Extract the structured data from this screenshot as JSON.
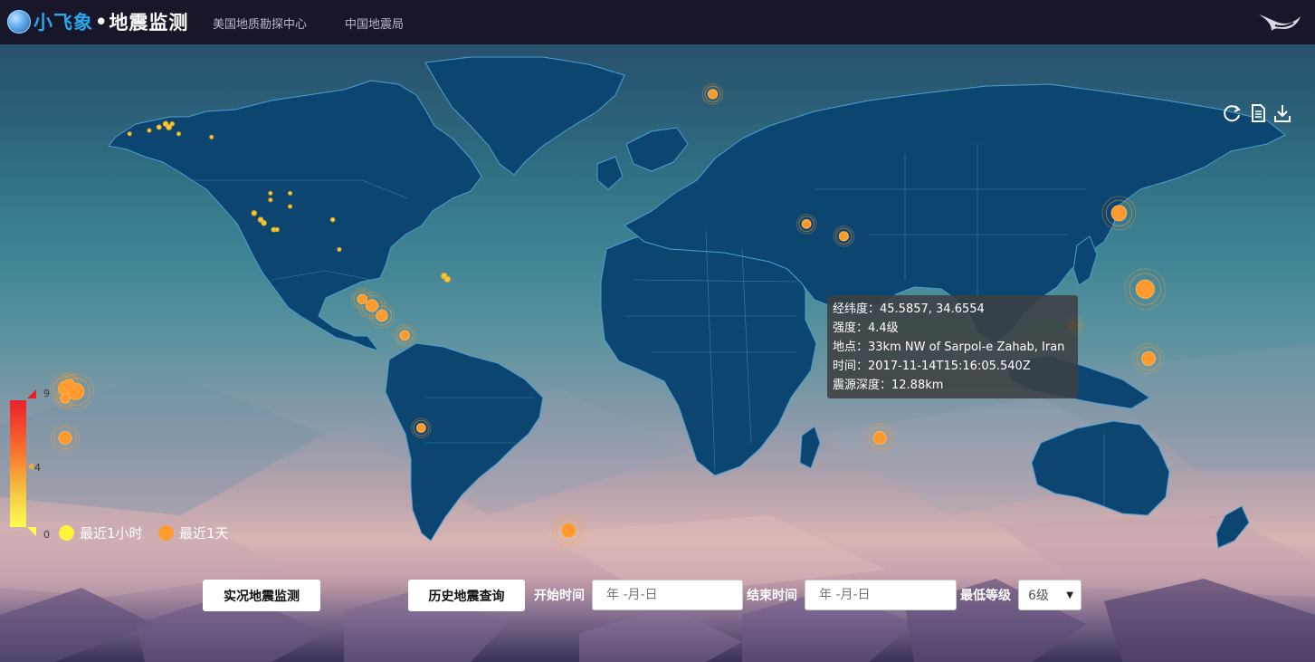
{
  "header": {
    "brand_primary": "小飞象",
    "brand_separator": "•",
    "brand_secondary": "地震监测",
    "nav": [
      "美国地质勘探中心",
      "中国地震局"
    ]
  },
  "toolbar": {
    "icons": [
      "refresh-icon",
      "document-icon",
      "download-icon"
    ]
  },
  "tooltip": {
    "coords": "经纬度：45.5857, 34.6554",
    "magnitude": "强度：4.4级",
    "place": "地点：33km NW of Sarpol-e Zahab, Iran",
    "time": "时间：2017-11-14T15:16:05.540Z",
    "depth": "震源深度：12.88km"
  },
  "legend": {
    "max": "9",
    "mid": "4",
    "min": "0",
    "last_hour": "最近1小时",
    "last_day": "最近1天",
    "colors": {
      "hour": "#fff23c",
      "day": "#ff9b2e",
      "high": "#e8202a",
      "low": "#fffb4e"
    }
  },
  "controls": {
    "live_button": "实况地震监测",
    "history_button": "历史地震查询",
    "start_label": "开始时间",
    "end_label": "结束时间",
    "date_placeholder": "年 -月-日",
    "level_label": "最低等级",
    "level_value": "6级"
  },
  "map": {
    "land_color": "#0c4670",
    "quakes": [
      {
        "lon": -161,
        "lat": 62,
        "mag": 2.0,
        "period": "hour"
      },
      {
        "lon": -155,
        "lat": 63,
        "mag": 2.0,
        "period": "hour"
      },
      {
        "lon": -152,
        "lat": 64,
        "mag": 2.4,
        "period": "hour"
      },
      {
        "lon": -150,
        "lat": 65,
        "mag": 2.6,
        "period": "hour"
      },
      {
        "lon": -149,
        "lat": 64,
        "mag": 2.8,
        "period": "hour"
      },
      {
        "lon": -148,
        "lat": 65,
        "mag": 2.2,
        "period": "hour"
      },
      {
        "lon": -146,
        "lat": 62,
        "mag": 2.0,
        "period": "hour"
      },
      {
        "lon": -136,
        "lat": 61,
        "mag": 2.0,
        "period": "hour"
      },
      {
        "lon": -118,
        "lat": 44,
        "mag": 2.0,
        "period": "hour"
      },
      {
        "lon": -118,
        "lat": 42,
        "mag": 2.0,
        "period": "hour"
      },
      {
        "lon": -112,
        "lat": 44,
        "mag": 2.0,
        "period": "hour"
      },
      {
        "lon": -112,
        "lat": 40,
        "mag": 2.0,
        "period": "hour"
      },
      {
        "lon": -123,
        "lat": 38,
        "mag": 2.6,
        "period": "hour"
      },
      {
        "lon": -121,
        "lat": 36,
        "mag": 2.6,
        "period": "hour"
      },
      {
        "lon": -120,
        "lat": 35,
        "mag": 2.6,
        "period": "hour"
      },
      {
        "lon": -117,
        "lat": 33,
        "mag": 2.4,
        "period": "hour"
      },
      {
        "lon": -116,
        "lat": 33,
        "mag": 2.2,
        "period": "hour"
      },
      {
        "lon": -99,
        "lat": 36,
        "mag": 2.2,
        "period": "hour"
      },
      {
        "lon": -97,
        "lat": 27,
        "mag": 2.0,
        "period": "hour"
      },
      {
        "lon": -65,
        "lat": 19,
        "mag": 3.0,
        "period": "hour"
      },
      {
        "lon": -64,
        "lat": 18,
        "mag": 3.0,
        "period": "hour"
      },
      {
        "lon": 17,
        "lat": 74,
        "mag": 4.5,
        "period": "day"
      },
      {
        "lon": 45.6,
        "lat": 34.7,
        "mag": 4.4,
        "period": "day"
      },
      {
        "lon": 57,
        "lat": 31,
        "mag": 4.5,
        "period": "day"
      },
      {
        "lon": -90,
        "lat": 12,
        "mag": 4.6,
        "period": "day"
      },
      {
        "lon": -87,
        "lat": 10,
        "mag": 5.2,
        "period": "day"
      },
      {
        "lon": -84,
        "lat": 7,
        "mag": 5.0,
        "period": "day"
      },
      {
        "lon": -77,
        "lat": 1,
        "mag": 4.6,
        "period": "day"
      },
      {
        "lon": -72,
        "lat": -27,
        "mag": 4.4,
        "period": "day"
      },
      {
        "lon": 141,
        "lat": 38,
        "mag": 6.0,
        "period": "day"
      },
      {
        "lon": 149,
        "lat": 15,
        "mag": 6.8,
        "period": "day"
      },
      {
        "lon": 150,
        "lat": -6,
        "mag": 5.6,
        "period": "day"
      },
      {
        "lon": 127,
        "lat": 4,
        "mag": 4.4,
        "period": "day"
      },
      {
        "lon": 68,
        "lat": -30,
        "mag": 5.4,
        "period": "day"
      },
      {
        "lon": -27,
        "lat": -58,
        "mag": 5.8,
        "period": "day"
      },
      {
        "lon": -177,
        "lat": -15,
        "mag": 5.6,
        "period": "day"
      },
      {
        "lon": -174,
        "lat": -16,
        "mag": 6.2,
        "period": "day"
      },
      {
        "lon": -176,
        "lat": -14,
        "mag": 5.0,
        "period": "day"
      },
      {
        "lon": -177,
        "lat": -18,
        "mag": 4.6,
        "period": "day"
      },
      {
        "lon": -177,
        "lat": -30,
        "mag": 5.4,
        "period": "day"
      }
    ]
  }
}
